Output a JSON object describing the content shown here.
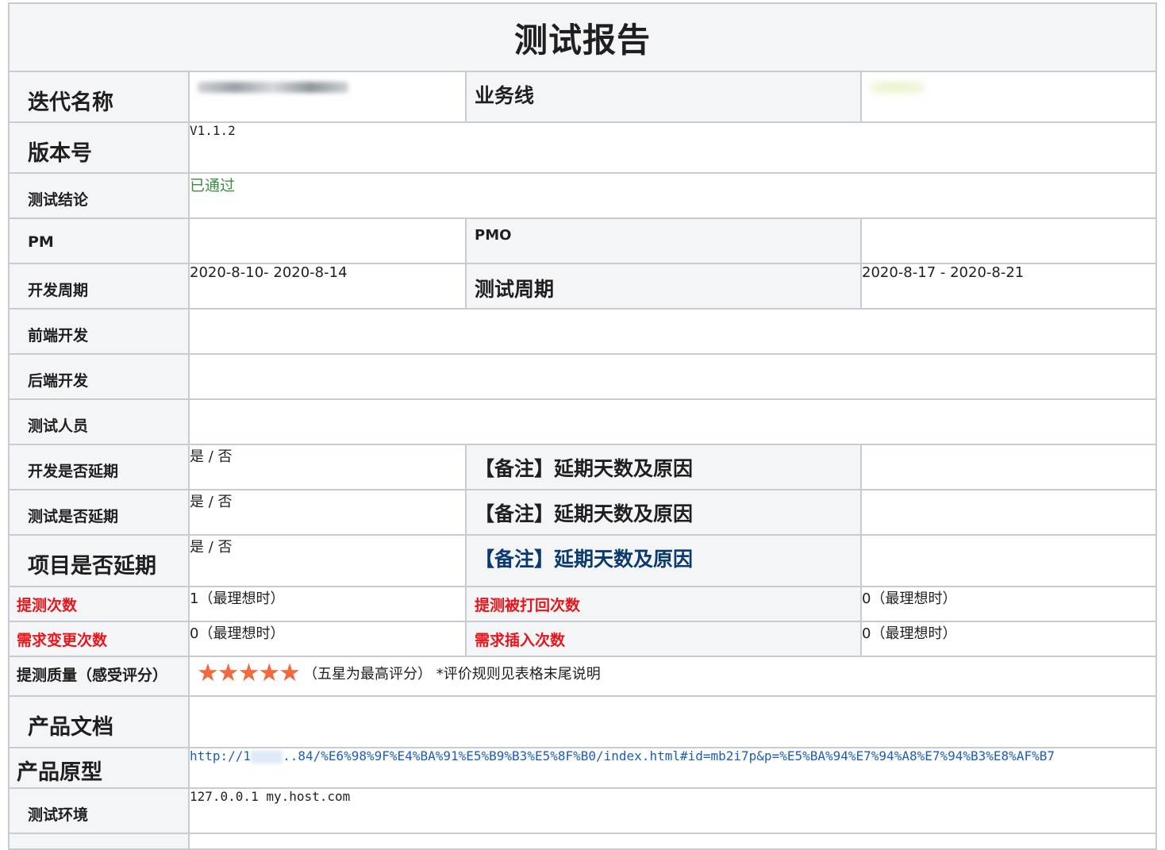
{
  "title": "测试报告",
  "iteration": {
    "label": "迭代名称",
    "value_redacted": true
  },
  "business_line": {
    "label": "业务线",
    "value_redacted": true
  },
  "version": {
    "label": "版本号",
    "value": "V1.1.2"
  },
  "conclusion": {
    "label": "测试结论",
    "value": "已通过",
    "color": "#3e8e41"
  },
  "pm": {
    "label": "PM",
    "value": ""
  },
  "pmo": {
    "label": "PMO",
    "value": ""
  },
  "dev_period": {
    "label": "开发周期",
    "value": "2020-8-10- 2020-8-14"
  },
  "test_period": {
    "label": "测试周期",
    "value": "2020-8-17 - 2020-8-21"
  },
  "frontend_dev": {
    "label": "前端开发",
    "value": ""
  },
  "backend_dev": {
    "label": "后端开发",
    "value": ""
  },
  "testers": {
    "label": "测试人员",
    "value": ""
  },
  "dev_delay": {
    "label": "开发是否延期",
    "value": "是 / 否",
    "note_label": "【备注】延期天数及原因"
  },
  "test_delay": {
    "label": "测试是否延期",
    "value": "是 / 否",
    "note_label": "【备注】延期天数及原因"
  },
  "project_delay": {
    "label": "项目是否延期",
    "value": "是 / 否",
    "note_label": "【备注】延期天数及原因"
  },
  "submit_count": {
    "label": "提测次数",
    "value": "1（最理想时）"
  },
  "rejected_count": {
    "label": "提测被打回次数",
    "value": "0（最理想时）"
  },
  "req_change_count": {
    "label": "需求变更次数",
    "value": "0（最理想时）"
  },
  "req_insert_count": {
    "label": "需求插入次数",
    "value": "0（最理想时）"
  },
  "quality": {
    "label": "提测质量（感受评分）",
    "stars": 5,
    "note": "（五星为最高评分）  *评价规则见表格末尾说明",
    "star_color": "#f16a3e"
  },
  "product_doc": {
    "label": "产品文档",
    "value": ""
  },
  "prototype": {
    "label": "产品原型",
    "link_prefix": "http://1",
    "link_suffix": "..84/%E6%98%9F%E4%BA%91%E5%B9%B3%E5%8F%B0/index.html#id=mb2i7p&p=%E5%BA%94%E7%94%A8%E7%94%B3%E8%AF%B7"
  },
  "environment": {
    "label": "测试环境",
    "value": "127.0.0.1 my.host.com"
  },
  "colors": {
    "label_bg": "#f4f5f7",
    "border": "#c7ccd3",
    "red_label": "#e8161b",
    "link": "#1c5dbf",
    "blue_label": "#0b3a6e"
  }
}
